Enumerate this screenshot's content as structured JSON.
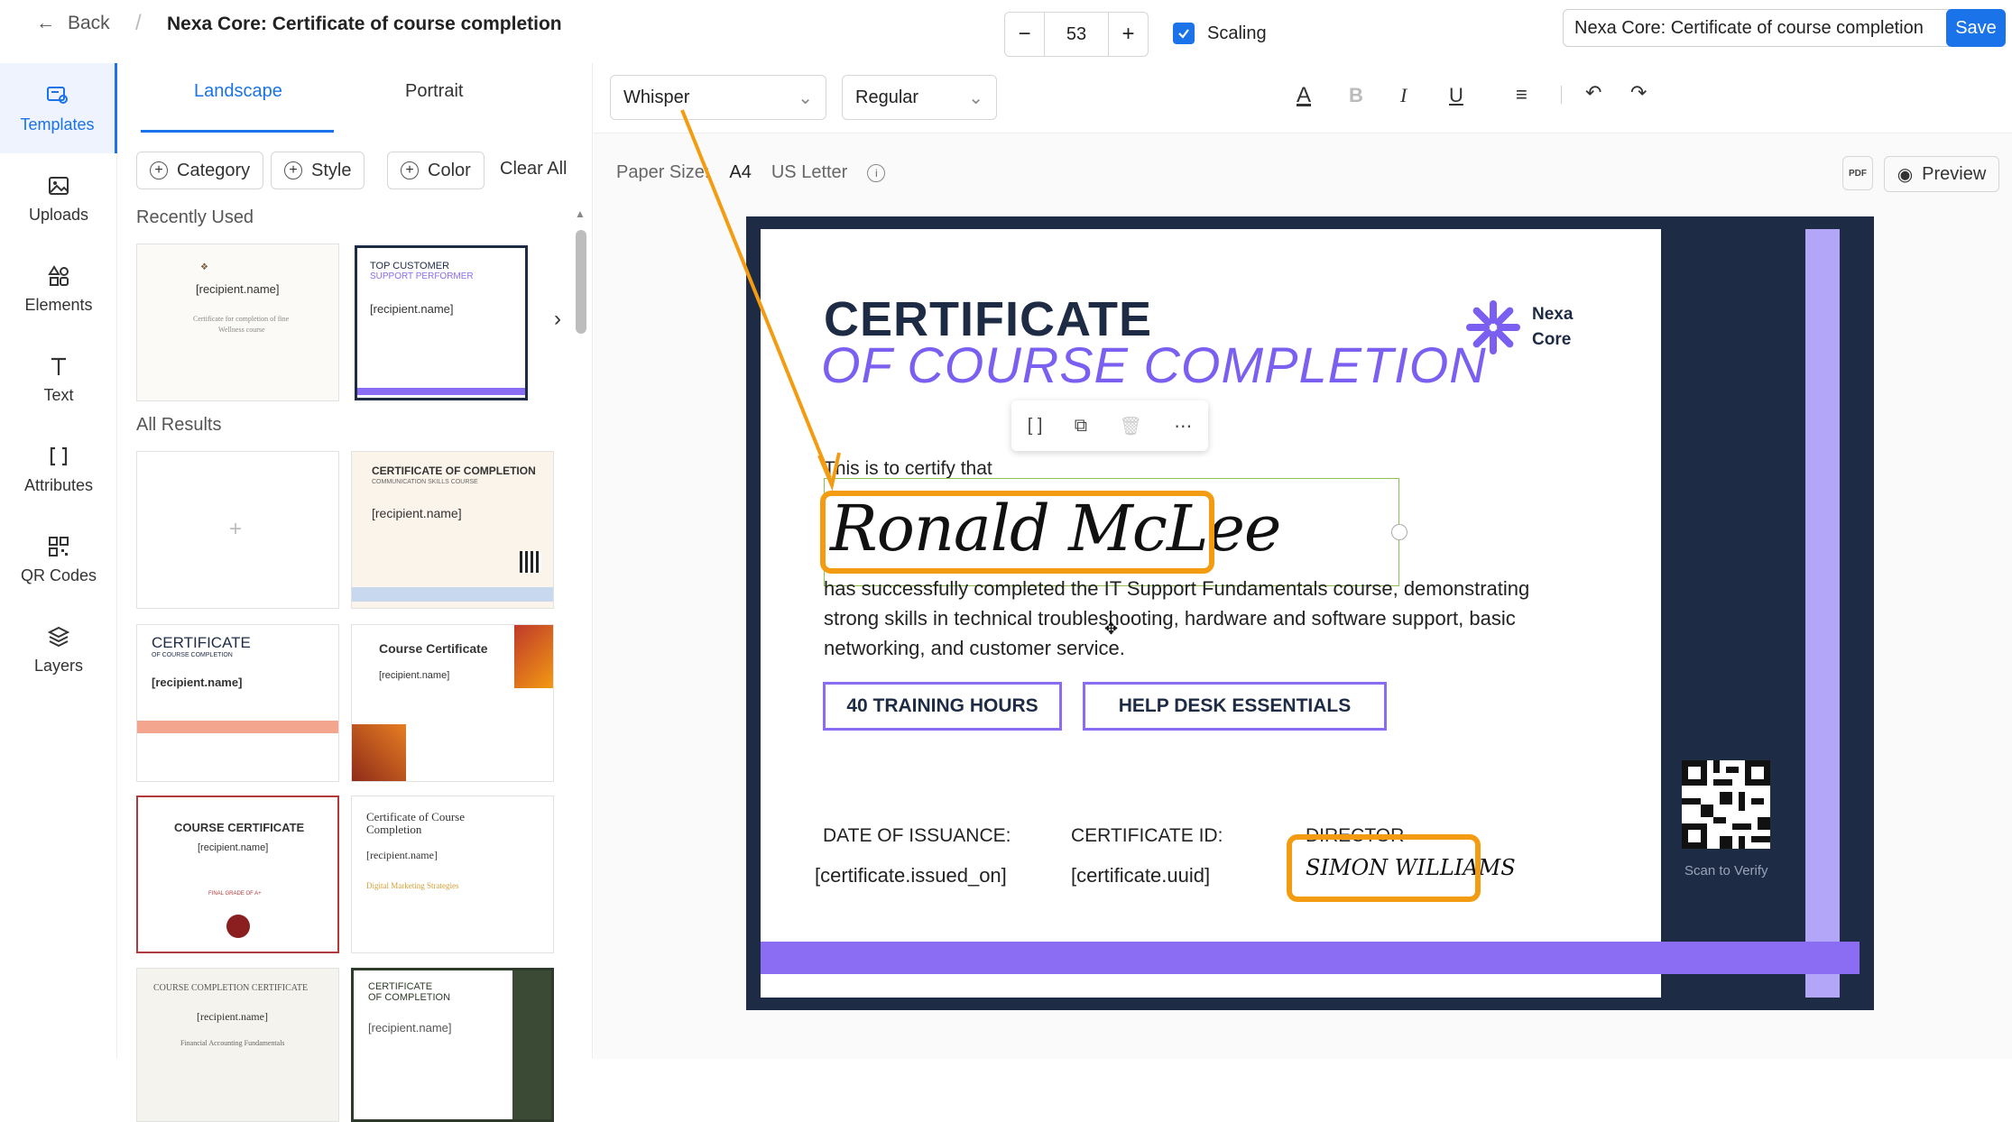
{
  "header": {
    "back_label": "Back",
    "title": "Nexa Core: Certificate of course completion",
    "title_input_value": "Nexa Core: Certificate of course completion",
    "save_label": "Save"
  },
  "rail": {
    "items": [
      {
        "label": "Templates",
        "icon": "templates-icon",
        "active": true
      },
      {
        "label": "Uploads",
        "icon": "image-icon"
      },
      {
        "label": "Elements",
        "icon": "shapes-icon"
      },
      {
        "label": "Text",
        "icon": "text-icon"
      },
      {
        "label": "Attributes",
        "icon": "brackets-icon"
      },
      {
        "label": "QR Codes",
        "icon": "qr-icon"
      },
      {
        "label": "Layers",
        "icon": "layers-icon"
      }
    ]
  },
  "panel": {
    "tabs": [
      "Landscape",
      "Portrait"
    ],
    "filters": [
      "Category",
      "Style",
      "Color"
    ],
    "clear_all": "Clear All",
    "recently_used": "Recently Used",
    "all_results": "All Results",
    "thumbs": {
      "r1_name": "[recipient.name]",
      "r1_line": "Certificate for completion of fine",
      "r1_line2": "Wellness course",
      "r2_title": "TOP CUSTOMER",
      "r2_sub": "SUPPORT PERFORMER",
      "r2_name": "[recipient.name]",
      "a2_title": "CERTIFICATE OF COMPLETION",
      "a2_sub": "COMMUNICATION SKILLS COURSE",
      "a2_name": "[recipient.name]",
      "a3_title": "CERTIFICATE",
      "a3_sub": "OF COURSE COMPLETION",
      "a3_name": "[recipient.name]",
      "a4_title": "Course Certificate",
      "a4_name": "[recipient.name]",
      "a5_title": "COURSE CERTIFICATE",
      "a5_name": "[recipient.name]",
      "a5_grade": "FINAL GRADE OF A+",
      "a6_title": "Certificate of Course Completion",
      "a6_name": "[recipient.name]",
      "a6_course": "Digital Marketing Strategies",
      "a7_title": "COURSE COMPLETION CERTIFICATE",
      "a7_name": "[recipient.name]",
      "a7_course": "Financial Accounting Fundamentals",
      "a8_title": "CERTIFICATE",
      "a8_sub": "OF COMPLETION",
      "a8_name": "[recipient.name]"
    }
  },
  "toolbar": {
    "font": "Whisper",
    "weight": "Regular",
    "size": "53",
    "scaling_label": "Scaling",
    "scaling_checked": true
  },
  "paper": {
    "label": "Paper Size:",
    "options": [
      "A4",
      "US Letter"
    ],
    "selected": "A4",
    "pdf_label": "PDF",
    "preview_label": "Preview"
  },
  "certificate": {
    "title_line1": "CERTIFICATE",
    "title_line2": "OF COURSE COMPLETION",
    "logo_line1": "Nexa",
    "logo_line2": "Core",
    "certify": "This is to certify that",
    "recipient": "Ronald McLee",
    "body": "has successfully completed the IT Support Fundamentals course, demonstrating strong skills in technical troubleshooting, hardware and software support, basic networking, and customer service.",
    "badge1": "40 TRAINING HOURS",
    "badge2": "HELP DESK ESSENTIALS",
    "date_label": "DATE OF ISSUANCE:",
    "date_value": "[certificate.issued_on]",
    "id_label": "CERTIFICATE ID:",
    "id_value": "[certificate.uuid]",
    "director_label": "DIRECTOR",
    "director_sig": "SIMON WILLIAMS",
    "scan": "Scan to Verify"
  },
  "colors": {
    "accent": "#1a73e8",
    "navy": "#1e2b45",
    "purple": "#8a6df3",
    "annotation": "#f39c12"
  }
}
